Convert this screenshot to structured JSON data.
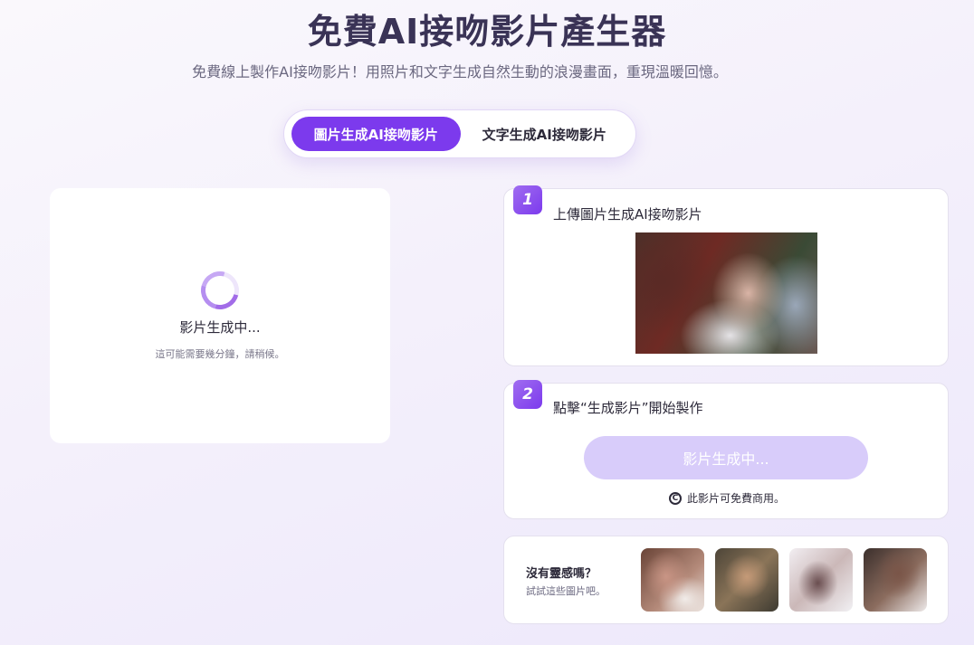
{
  "header": {
    "title": "免費AI接吻影片產生器",
    "subtitle": "免費線上製作AI接吻影片！用照片和文字生成自然生動的浪漫畫面，重現溫暖回憶。"
  },
  "tabs": [
    {
      "label": "圖片生成AI接吻影片",
      "active": true
    },
    {
      "label": "文字生成AI接吻影片",
      "active": false
    }
  ],
  "preview": {
    "status": "影片生成中...",
    "hint": "這可能需要幾分鐘，請稍候。"
  },
  "step1": {
    "number": "1",
    "label": "上傳圖片生成AI接吻影片"
  },
  "step2": {
    "number": "2",
    "label": "點擊“生成影片”開始製作",
    "button_label": "影片生成中...",
    "license_icon": "C",
    "license_text": "此影片可免費商用。"
  },
  "inspiration": {
    "title": "沒有靈感嗎？",
    "subtitle": "試試這些圖片吧。"
  },
  "colors": {
    "accent": "#7c3aed",
    "button_disabled": "#d8ccfa"
  }
}
